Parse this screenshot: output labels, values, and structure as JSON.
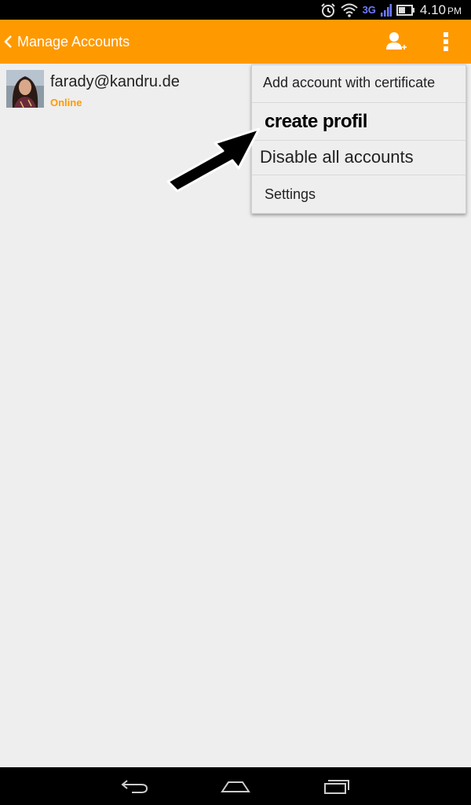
{
  "status_bar": {
    "network": "3G",
    "time": "4.10",
    "ampm": "PM",
    "icons": [
      "alarm-icon",
      "wifi-icon",
      "signal-icon",
      "battery-icon"
    ]
  },
  "action_bar": {
    "title": "Manage Accounts",
    "color": "#ff9900",
    "icons": [
      "back-chevron-icon",
      "add-user-icon",
      "overflow-menu-icon"
    ]
  },
  "accounts": [
    {
      "email": "farady@kandru.de",
      "status": "Online",
      "status_color": "#ff9900"
    }
  ],
  "menu": {
    "items": [
      {
        "label": "Add account with certificate"
      },
      {
        "label": "create profil"
      },
      {
        "label": "Disable all accounts"
      },
      {
        "label": "Settings"
      }
    ]
  },
  "nav_bar": {
    "icons": [
      "back-icon",
      "home-icon",
      "recent-apps-icon"
    ]
  }
}
